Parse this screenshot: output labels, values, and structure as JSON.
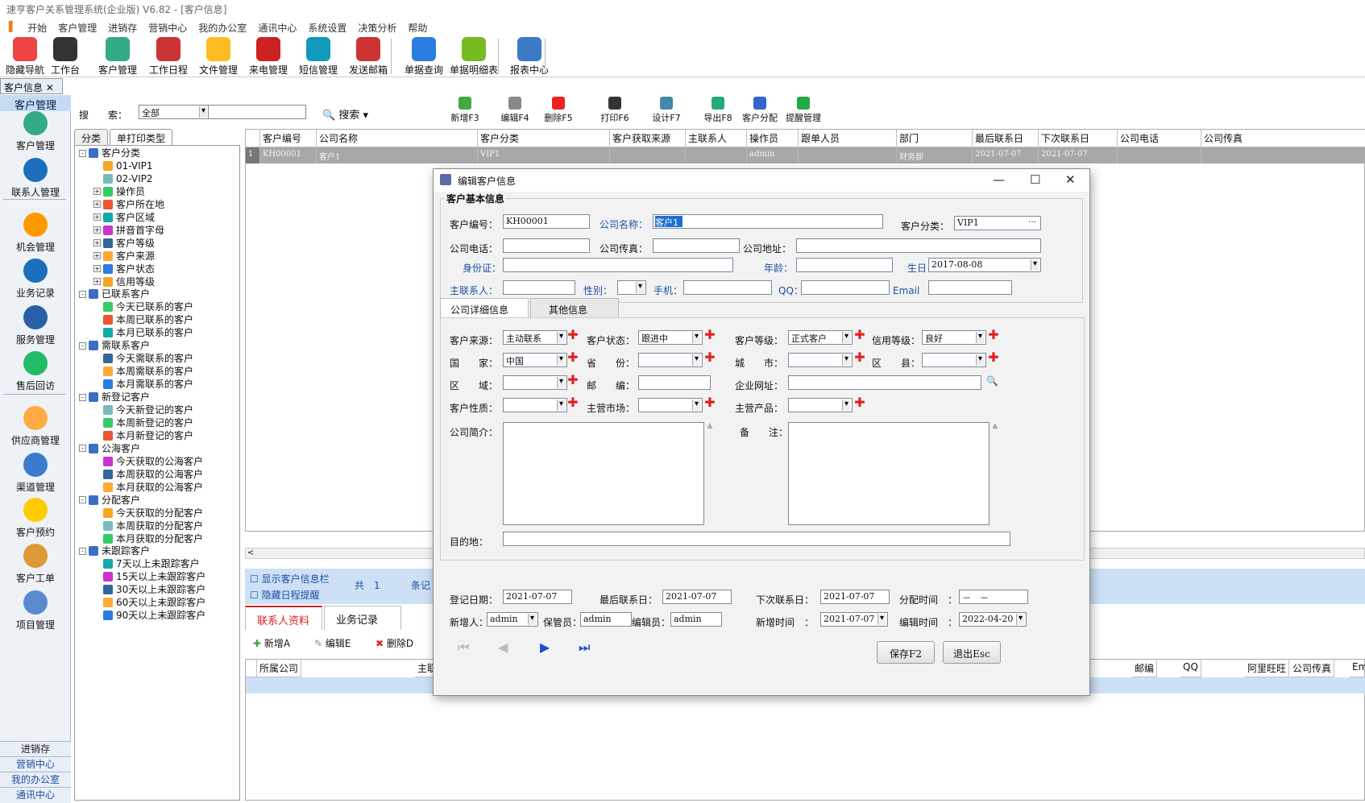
{
  "window": {
    "title": "速亨客户关系管理系统(企业版) V6.82 - [客户信息]"
  },
  "menu": [
    "开始",
    "客户管理",
    "进销存",
    "营销中心",
    "我的办公室",
    "通讯中心",
    "系统设置",
    "决策分析",
    "帮助"
  ],
  "toolbar": [
    "隐藏导航",
    "工作台",
    "客户管理",
    "工作日程",
    "文件管理",
    "来电管理",
    "短信管理",
    "发送邮箱",
    "单据查询",
    "单据明细表",
    "报表中心"
  ],
  "doc_tab": "客户信息",
  "leftnav": {
    "header": "客户管理",
    "items": [
      "客户管理",
      "联系人管理",
      "机会管理",
      "业务记录",
      "服务管理",
      "售后回访",
      "供应商管理",
      "渠道管理",
      "客户预约",
      "客户工单",
      "项目管理"
    ],
    "bottom": [
      "进销存",
      "营销中心",
      "我的办公室",
      "通讯中心"
    ]
  },
  "search": {
    "label": "搜　　索：",
    "scope": "全部",
    "button": "搜索"
  },
  "actions": [
    "新增F3",
    "编辑F4",
    "删除F5",
    "打印F6",
    "设计F7",
    "导出F8",
    "客户分配",
    "提醒管理"
  ],
  "tree_tabs": [
    "分类",
    "单打印类型"
  ],
  "tree": [
    {
      "t": "客户分类",
      "lvl": 0,
      "pm": "-"
    },
    {
      "t": "01-VIP1",
      "lvl": 1
    },
    {
      "t": "02-VIP2",
      "lvl": 1
    },
    {
      "t": "操作员",
      "lvl": 1,
      "pm": "+"
    },
    {
      "t": "客户所在地",
      "lvl": 1,
      "pm": "+"
    },
    {
      "t": "客户区域",
      "lvl": 1,
      "pm": "+"
    },
    {
      "t": "拼音首字母",
      "lvl": 1,
      "pm": "+"
    },
    {
      "t": "客户等级",
      "lvl": 1,
      "pm": "+"
    },
    {
      "t": "客户来源",
      "lvl": 1,
      "pm": "+"
    },
    {
      "t": "客户状态",
      "lvl": 1,
      "pm": "+"
    },
    {
      "t": "信用等级",
      "lvl": 1,
      "pm": "+"
    },
    {
      "t": "已联系客户",
      "lvl": 0,
      "pm": "-"
    },
    {
      "t": "今天已联系的客户",
      "lvl": 1
    },
    {
      "t": "本周已联系的客户",
      "lvl": 1
    },
    {
      "t": "本月已联系的客户",
      "lvl": 1
    },
    {
      "t": "需联系客户",
      "lvl": 0,
      "pm": "-"
    },
    {
      "t": "今天需联系的客户",
      "lvl": 1
    },
    {
      "t": "本周需联系的客户",
      "lvl": 1
    },
    {
      "t": "本月需联系的客户",
      "lvl": 1
    },
    {
      "t": "新登记客户",
      "lvl": 0,
      "pm": "-"
    },
    {
      "t": "今天新登记的客户",
      "lvl": 1
    },
    {
      "t": "本周新登记的客户",
      "lvl": 1
    },
    {
      "t": "本月新登记的客户",
      "lvl": 1
    },
    {
      "t": "公海客户",
      "lvl": 0,
      "pm": "-"
    },
    {
      "t": "今天获取的公海客户",
      "lvl": 1
    },
    {
      "t": "本周获取的公海客户",
      "lvl": 1
    },
    {
      "t": "本月获取的公海客户",
      "lvl": 1
    },
    {
      "t": "分配客户",
      "lvl": 0,
      "pm": "-"
    },
    {
      "t": "今天获取的分配客户",
      "lvl": 1
    },
    {
      "t": "本周获取的分配客户",
      "lvl": 1
    },
    {
      "t": "本月获取的分配客户",
      "lvl": 1
    },
    {
      "t": "未跟踪客户",
      "lvl": 0,
      "pm": "-"
    },
    {
      "t": "7天以上未跟踪客户",
      "lvl": 1
    },
    {
      "t": "15天以上未跟踪客户",
      "lvl": 1
    },
    {
      "t": "30天以上未跟踪客户",
      "lvl": 1
    },
    {
      "t": "60天以上未跟踪客户",
      "lvl": 1
    },
    {
      "t": "90天以上未跟踪客户",
      "lvl": 1
    }
  ],
  "grid": {
    "columns": [
      "客户编号",
      "公司名称",
      "客户分类",
      "客户获取来源",
      "主联系人",
      "操作员",
      "跟单人员",
      "部门",
      "最后联系日",
      "下次联系日",
      "公司电话",
      "公司传真"
    ],
    "row": [
      "KH00001",
      "客户1",
      "VIP1",
      "",
      "",
      "admin",
      "",
      "财务部",
      "2021-07-07",
      "2021-07-07",
      "",
      ""
    ],
    "row_indicator": "1"
  },
  "bluebar": {
    "show_info": "显示客户信息栏",
    "hide_schedule": "隐藏日程提醒",
    "total": "共　1",
    "records": "条记"
  },
  "detail_tabs": [
    "联系人资料",
    "业务记录"
  ],
  "detail_actions": [
    "新增A",
    "编辑E",
    "删除D"
  ],
  "detail_grid": {
    "columns": [
      "所属公司",
      "主联",
      "邮编",
      "QQ",
      "阿里旺旺",
      "公司传真",
      "Em"
    ]
  },
  "dialog": {
    "title": "编辑客户信息",
    "section": "客户基本信息",
    "labels": {
      "code": "客户编号：",
      "company": "公司名称：",
      "category": "客户分类：",
      "phone": "公司电话：",
      "fax": "公司传真：",
      "address": "公司地址：",
      "id": "身份证：",
      "age": "年龄：",
      "birthday": "生日：",
      "contact": "主联系人：",
      "gender": "性别：",
      "mobile": "手机：",
      "qq": "QQ：",
      "email": "Email　："
    },
    "values": {
      "code": "KH00001",
      "company": "客户1",
      "category": "VIP1",
      "birthday": "2017-08-08"
    },
    "tabs": [
      "公司详细信息",
      "其他信息"
    ],
    "detail": {
      "source_l": "客户来源：",
      "source": "主动联系",
      "status_l": "客户状态：",
      "status": "跟进中",
      "level_l": "客户等级：",
      "level": "正式客户",
      "credit_l": "信用等级：",
      "credit": "良好",
      "country_l": "国　　家：",
      "country": "中国",
      "province_l": "省　　份：",
      "city_l": "城　　市：",
      "district_l": "区　　县：",
      "region_l": "区　　域：",
      "zip_l": "邮　　编：",
      "web_l": "企业网址：",
      "nature_l": "客户性质：",
      "market_l": "主营市场：",
      "product_l": "主营产品：",
      "intro_l": "公司简介：",
      "remark_l": "备　　注：",
      "dest_l": "目的地："
    },
    "footer": {
      "reg_l": "登记日期：",
      "reg": "2021-07-07",
      "last_l": "最后联系日：",
      "last": "2021-07-07",
      "next_l": "下次联系日：",
      "next": "2021-07-07",
      "assign_l": "分配时间　：",
      "assign": "－　－",
      "adder_l": "新增人：",
      "adder": "admin",
      "keeper_l": "保管员：",
      "keeper": "admin",
      "editor_l": "编辑员：",
      "editor": "admin",
      "addtime_l": "新增时间　：",
      "addtime": "2021-07-07",
      "edittime_l": "编辑时间　：",
      "edittime": "2022-04-20"
    },
    "buttons": {
      "save": "保存F2",
      "exit": "退出Esc"
    }
  }
}
